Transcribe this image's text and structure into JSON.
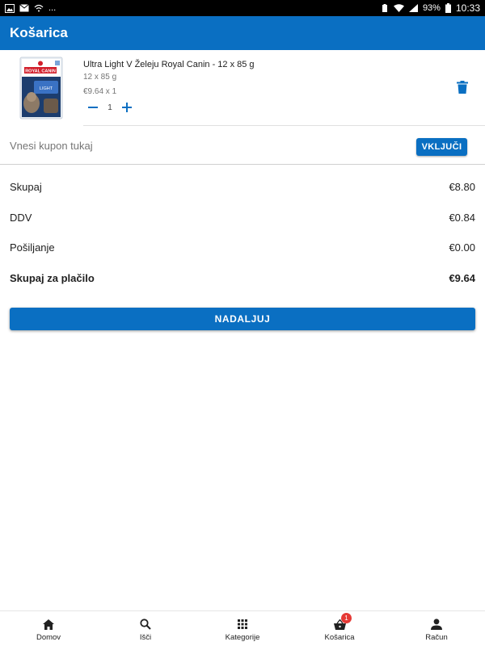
{
  "status_bar": {
    "battery": "93%",
    "time": "10:33",
    "dots": "..."
  },
  "app_bar": {
    "title": "Košarica"
  },
  "cart_item": {
    "brand_logo_text": "ROYAL CANIN",
    "pack_label": "LIGHT",
    "name": "Ultra Light V Želeju Royal Canin - 12 x 85 g",
    "size": "12 x 85 g",
    "price_line": "€9.64 x 1",
    "quantity": "1",
    "icons": {
      "decrease": "minus-icon",
      "increase": "plus-icon",
      "delete": "trash-icon"
    }
  },
  "coupon": {
    "placeholder": "Vnesi kupon tukaj",
    "value": "",
    "button_label": "VKLJUČI"
  },
  "totals": {
    "rows": [
      {
        "label": "Skupaj",
        "value": "€8.80"
      },
      {
        "label": "DDV",
        "value": "€0.84"
      },
      {
        "label": "Pošiljanje",
        "value": "€0.00"
      },
      {
        "label": "Skupaj za plačilo",
        "value": "€9.64"
      }
    ]
  },
  "continue_button": {
    "label": "NADALJUJ"
  },
  "bottom_nav": {
    "items": [
      {
        "label": "Domov",
        "icon": "home-icon"
      },
      {
        "label": "Išči",
        "icon": "search-icon"
      },
      {
        "label": "Kategorije",
        "icon": "grid-icon"
      },
      {
        "label": "Košarica",
        "icon": "basket-icon",
        "badge": "1"
      },
      {
        "label": "Račun",
        "icon": "person-icon"
      }
    ]
  },
  "colors": {
    "primary": "#0a6fc2",
    "badge": "#e53935",
    "status_bar": "#000000"
  }
}
